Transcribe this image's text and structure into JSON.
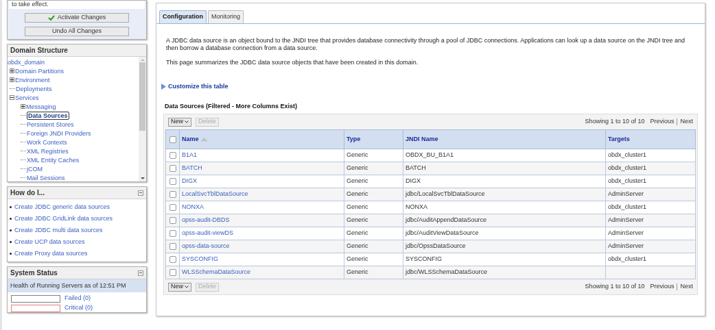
{
  "change_center": {
    "message": "to take effect.",
    "buttons": [
      {
        "label": "Activate Changes",
        "kind": "activate"
      },
      {
        "label": "Undo All Changes",
        "kind": "undo"
      }
    ]
  },
  "domain_structure": {
    "title": "Domain Structure",
    "tree": [
      {
        "label": "obdx_domain",
        "selected": false,
        "children": [
          {
            "label": "Domain Partitions",
            "selected": false,
            "expanded": false
          },
          {
            "label": "Environment",
            "selected": false,
            "expanded": false
          },
          {
            "label": "Deployments",
            "selected": false
          },
          {
            "label": "Services",
            "selected": false,
            "expanded": true,
            "children": [
              {
                "label": "Messaging",
                "selected": false,
                "expanded": false
              },
              {
                "label": "Data Sources",
                "selected": true
              },
              {
                "label": "Persistent Stores",
                "selected": false
              },
              {
                "label": "Foreign JNDI Providers",
                "selected": false
              },
              {
                "label": "Work Contexts",
                "selected": false
              },
              {
                "label": "XML Registries",
                "selected": false
              },
              {
                "label": "XML Entity Caches",
                "selected": false
              },
              {
                "label": "jCOM",
                "selected": false
              },
              {
                "label": "Mail Sessions",
                "selected": false
              }
            ]
          }
        ]
      }
    ]
  },
  "how_do_i": {
    "title": "How do I...",
    "links": [
      "Create JDBC generic data sources",
      "Create JDBC GridLink data sources",
      "Create JDBC multi data sources",
      "Create UCP data sources",
      "Create Proxy data sources"
    ]
  },
  "system_status": {
    "title": "System Status",
    "health_heading": "Health of Running Servers as of  12:51 PM",
    "health": [
      {
        "label": "Failed (0)",
        "color": "#808080"
      },
      {
        "label": "Critical (0)",
        "color": "#e08080"
      }
    ]
  },
  "tabs": [
    {
      "label": "Configuration",
      "selected": true
    },
    {
      "label": "Monitoring",
      "selected": false
    }
  ],
  "intro": [
    "A JDBC data source is an object bound to the JNDI tree that provides database connectivity through a pool of JDBC connections. Applications can look up a data source on the JNDI tree and then borrow a database connection from a data source.",
    "This page summarizes the JDBC data source objects that have been created in this domain."
  ],
  "customize_link": "Customize this table",
  "table": {
    "title": "Data Sources (Filtered - More Columns Exist)",
    "toolbars": [
      {
        "new": "New",
        "delete": "Delete",
        "delete_disabled": true,
        "showing": "Showing 1 to 10 of 10",
        "previous": "Previous",
        "next": "Next"
      },
      {
        "new": "New",
        "delete": "Delete",
        "delete_disabled": true,
        "showing": "Showing 1 to 10 of 10",
        "previous": "Previous",
        "next": "Next"
      }
    ],
    "select_all_checked": false,
    "columns": [
      "Name",
      "Type",
      "JNDI Name",
      "Targets"
    ],
    "rows": [
      {
        "checked": false,
        "cells": [
          "B1A1",
          "Generic",
          "OBDX_BU_B1A1",
          "obdx_cluster1"
        ]
      },
      {
        "checked": false,
        "cells": [
          "BATCH",
          "Generic",
          "BATCH",
          "obdx_cluster1"
        ]
      },
      {
        "checked": false,
        "cells": [
          "DIGX",
          "Generic",
          "DIGX",
          "obdx_cluster1"
        ]
      },
      {
        "checked": false,
        "cells": [
          "LocalSvcTblDataSource",
          "Generic",
          "jdbc/LocalSvcTblDataSource",
          "AdminServer"
        ]
      },
      {
        "checked": false,
        "cells": [
          "NONXA",
          "Generic",
          "NONXA",
          "obdx_cluster1"
        ]
      },
      {
        "checked": false,
        "cells": [
          "opss-audit-DBDS",
          "Generic",
          "jdbc/AuditAppendDataSource",
          "AdminServer"
        ]
      },
      {
        "checked": false,
        "cells": [
          "opss-audit-viewDS",
          "Generic",
          "jdbc/AuditViewDataSource",
          "AdminServer"
        ]
      },
      {
        "checked": false,
        "cells": [
          "opss-data-source",
          "Generic",
          "jdbc/OpssDataSource",
          "AdminServer"
        ]
      },
      {
        "checked": false,
        "cells": [
          "SYSCONFIG",
          "Generic",
          "SYSCONFIG",
          "obdx_cluster1"
        ]
      },
      {
        "checked": false,
        "cells": [
          "WLSSchemaDataSource",
          "Generic",
          "jdbc/WLSSchemaDataSource",
          ""
        ]
      }
    ]
  }
}
